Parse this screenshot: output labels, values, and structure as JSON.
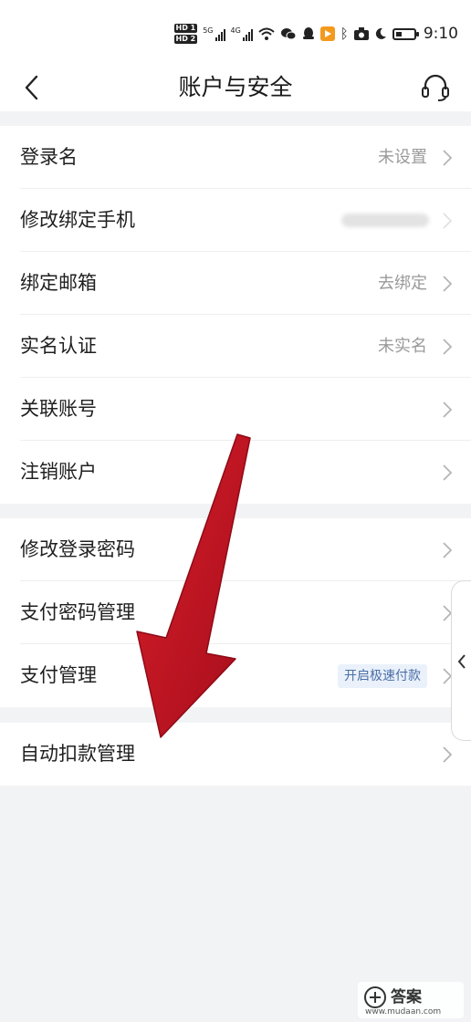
{
  "status_bar": {
    "hd1": "HD 1",
    "hd2": "HD 2",
    "signal1": "5G",
    "signal2": "4G",
    "time": "9:10"
  },
  "nav": {
    "title": "账户与安全"
  },
  "group1": [
    {
      "label": "登录名",
      "value": "未设置"
    },
    {
      "label": "修改绑定手机",
      "value": ""
    },
    {
      "label": "绑定邮箱",
      "value": "去绑定"
    },
    {
      "label": "实名认证",
      "value": "未实名"
    },
    {
      "label": "关联账号",
      "value": ""
    },
    {
      "label": "注销账户",
      "value": ""
    }
  ],
  "group2": [
    {
      "label": "修改登录密码"
    },
    {
      "label": "支付密码管理"
    },
    {
      "label": "支付管理",
      "tag": "开启极速付款"
    }
  ],
  "group3": [
    {
      "label": "自动扣款管理"
    }
  ],
  "watermark": {
    "name": "答案",
    "url": "www.mudaan.com"
  },
  "colors": {
    "page_bg": "#f2f3f5",
    "card_bg": "#ffffff",
    "value_text": "#9a9a9a",
    "tag_text": "#4a6fa5",
    "tag_bg": "#eaf1fb",
    "arrow": "#c8102e"
  },
  "icons": {
    "back": "chevron-left-icon",
    "customer_service": "headset-icon",
    "row_chevron": "chevron-right-icon",
    "side_handle": "chevron-left-icon"
  }
}
